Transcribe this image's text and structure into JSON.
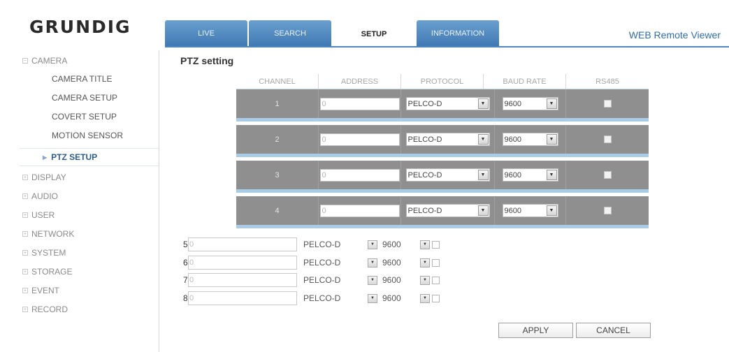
{
  "brand": "GRUNDIG",
  "app_title": "WEB Remote Viewer",
  "tabs": [
    {
      "label": "LIVE"
    },
    {
      "label": "SEARCH"
    },
    {
      "label": "SETUP"
    },
    {
      "label": "INFORMATION"
    }
  ],
  "sidebar": {
    "camera": "CAMERA",
    "camera_items": [
      "CAMERA TITLE",
      "CAMERA SETUP",
      "COVERT SETUP",
      "MOTION SENSOR",
      "PTZ SETUP"
    ],
    "sections": [
      "DISPLAY",
      "AUDIO",
      "USER",
      "NETWORK",
      "SYSTEM",
      "STORAGE",
      "EVENT",
      "RECORD"
    ]
  },
  "page_title": "PTZ setting",
  "table": {
    "headers": [
      "CHANNEL",
      "ADDRESS",
      "PROTOCOL",
      "BAUD RATE",
      "RS485"
    ],
    "rows": [
      {
        "channel": "1",
        "address": "0",
        "protocol": "PELCO-D",
        "baud": "9600",
        "rs485": false
      },
      {
        "channel": "2",
        "address": "0",
        "protocol": "PELCO-D",
        "baud": "9600",
        "rs485": false
      },
      {
        "channel": "3",
        "address": "0",
        "protocol": "PELCO-D",
        "baud": "9600",
        "rs485": false
      },
      {
        "channel": "4",
        "address": "0",
        "protocol": "PELCO-D",
        "baud": "9600",
        "rs485": false
      }
    ]
  },
  "extra_rows": [
    {
      "channel": "5",
      "address": "0",
      "protocol": "PELCO-D",
      "baud": "9600"
    },
    {
      "channel": "6",
      "address": "0",
      "protocol": "PELCO-D",
      "baud": "9600"
    },
    {
      "channel": "7",
      "address": "0",
      "protocol": "PELCO-D",
      "baud": "9600"
    },
    {
      "channel": "8",
      "address": "0",
      "protocol": "PELCO-D",
      "baud": "9600"
    }
  ],
  "buttons": {
    "apply": "APPLY",
    "cancel": "CANCEL"
  },
  "colors": {
    "tab_blue": "#4f86bd",
    "row_gray": "#8f8f8f",
    "row_sep": "#a9cde7"
  }
}
